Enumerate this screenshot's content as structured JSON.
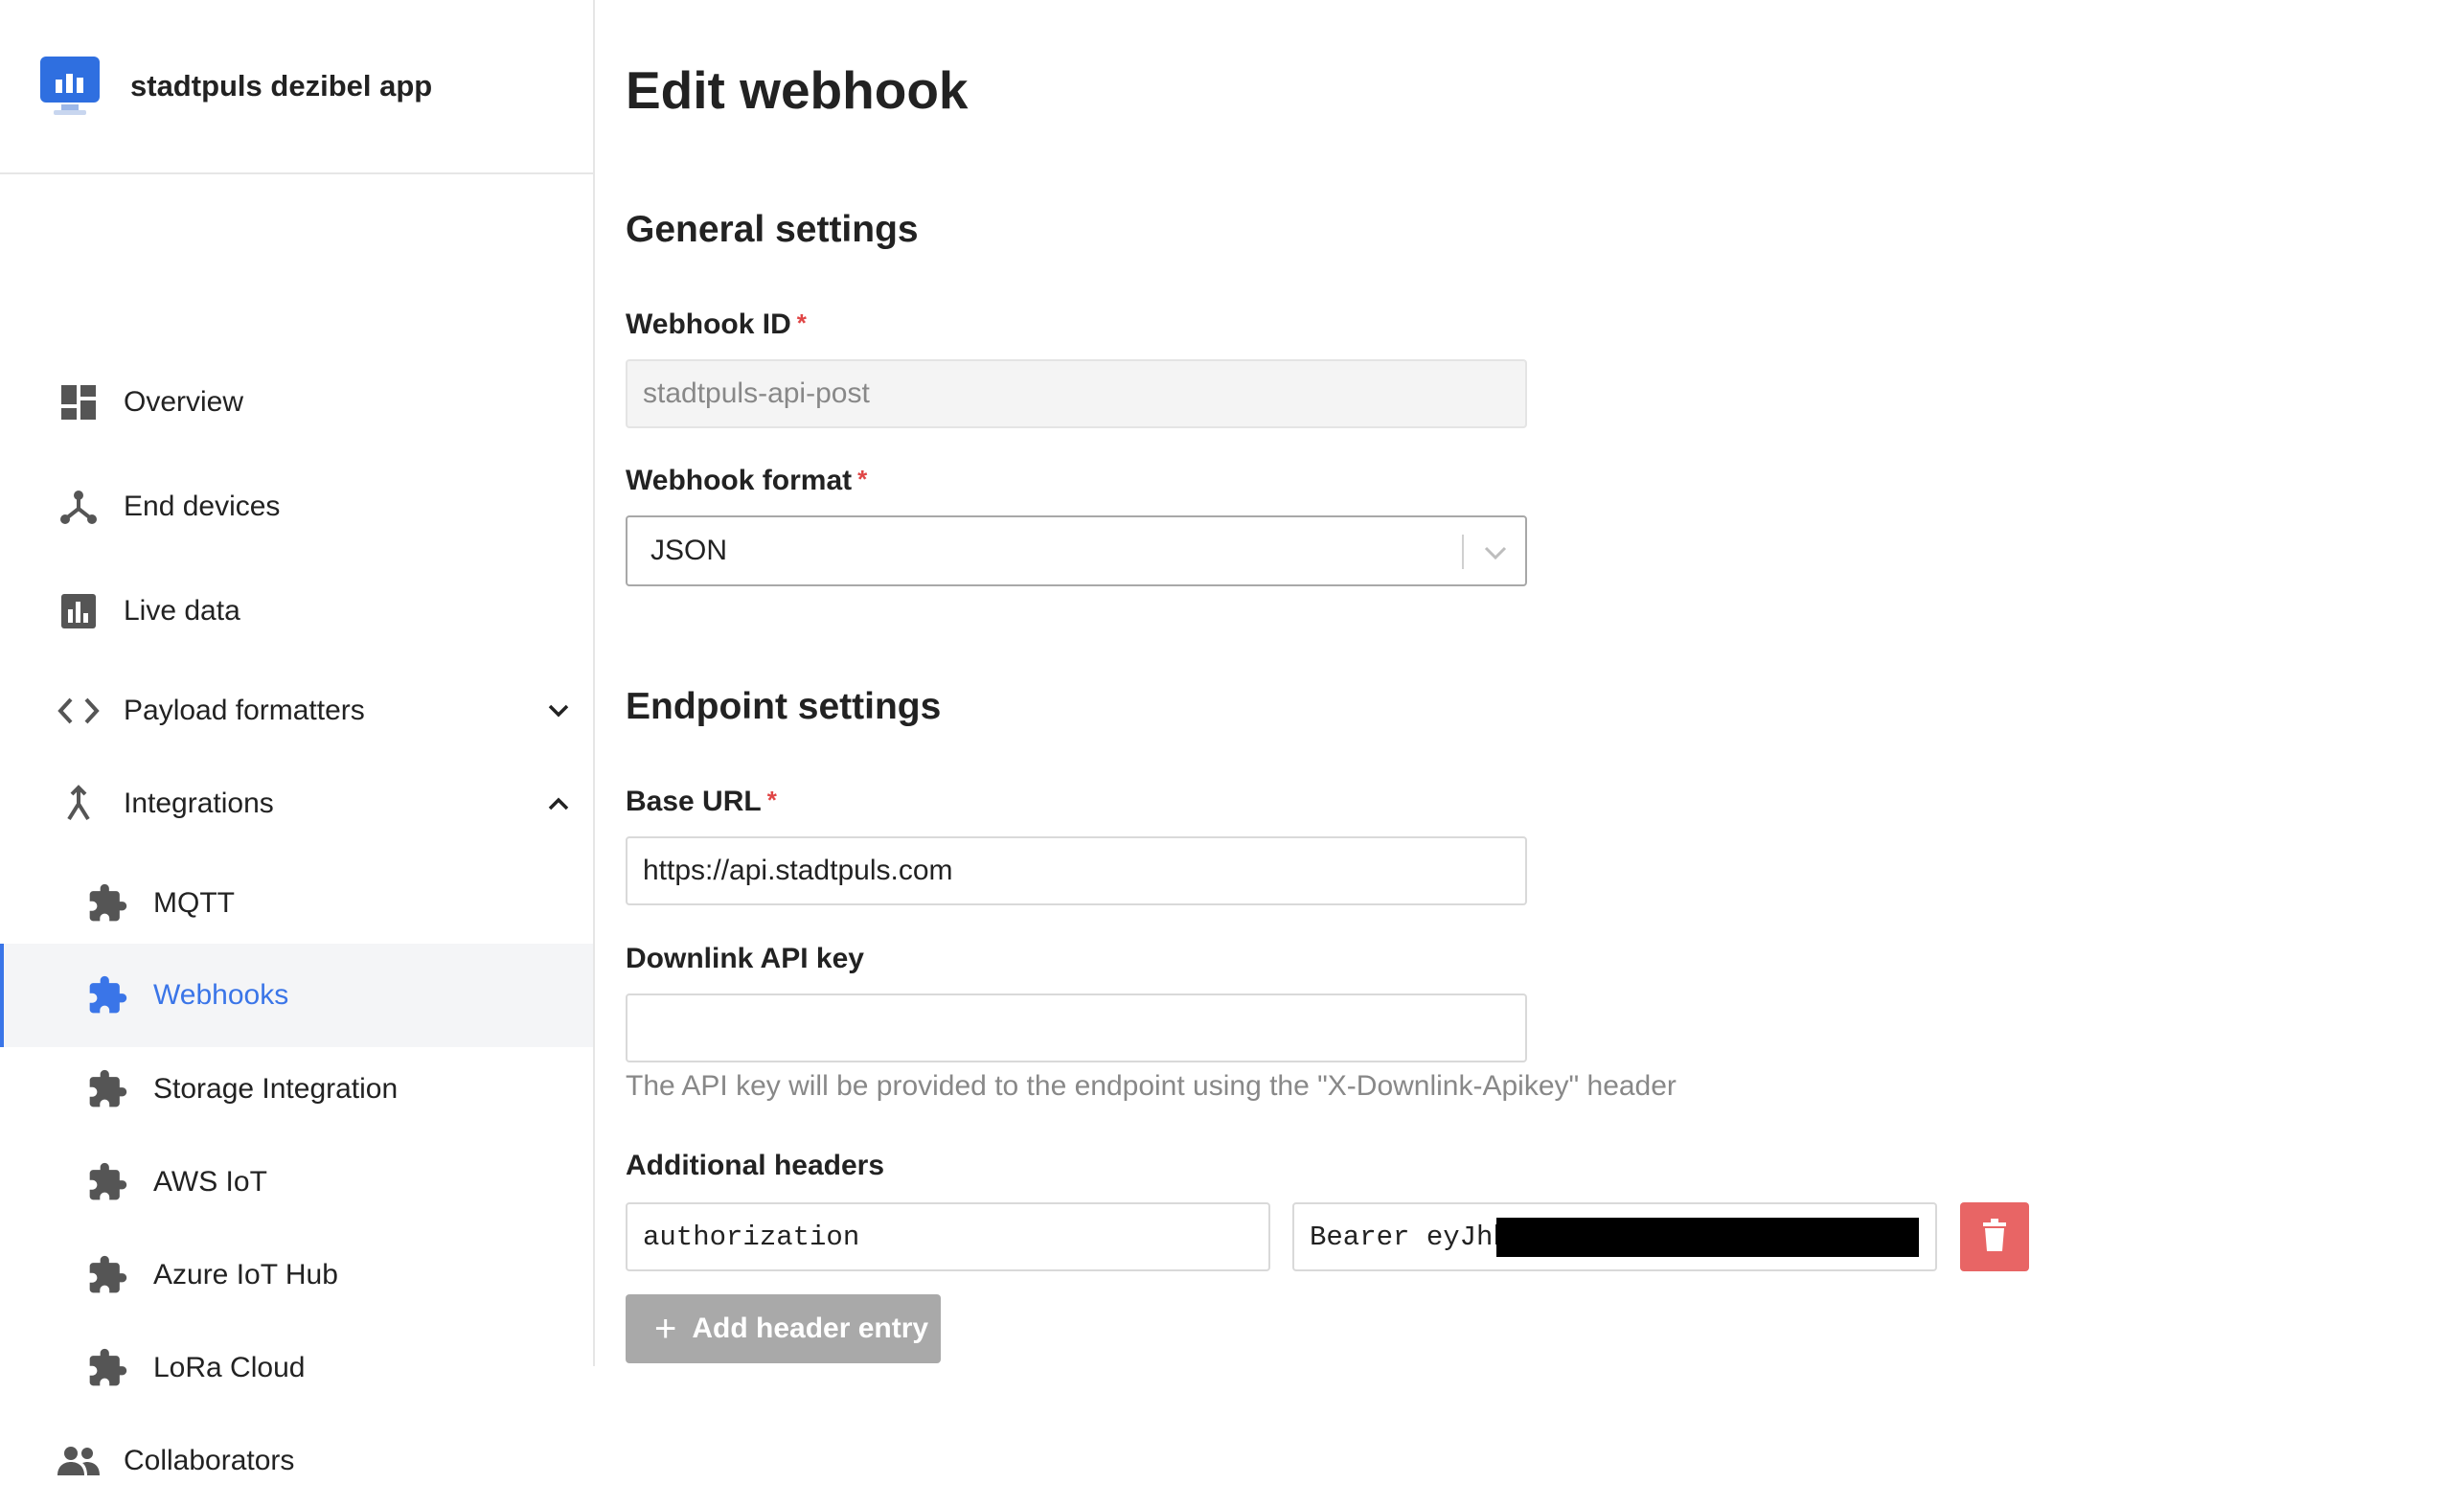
{
  "app": {
    "name": "stadtpuls dezibel app",
    "logo_icon": "monitor-chart-icon"
  },
  "sidebar": {
    "items": [
      {
        "label": "Overview",
        "icon": "dashboard-icon"
      },
      {
        "label": "End devices",
        "icon": "devices-icon"
      },
      {
        "label": "Live data",
        "icon": "bar-chart-icon"
      },
      {
        "label": "Payload formatters",
        "icon": "code-icon",
        "expanded": false
      },
      {
        "label": "Integrations",
        "icon": "merge-icon",
        "expanded": true
      },
      {
        "label": "MQTT",
        "icon": "puzzle-icon"
      },
      {
        "label": "Webhooks",
        "icon": "puzzle-icon",
        "active": true
      },
      {
        "label": "Storage Integration",
        "icon": "puzzle-icon"
      },
      {
        "label": "AWS IoT",
        "icon": "puzzle-icon"
      },
      {
        "label": "Azure IoT Hub",
        "icon": "puzzle-icon"
      },
      {
        "label": "LoRa Cloud",
        "icon": "puzzle-icon"
      },
      {
        "label": "Collaborators",
        "icon": "people-icon"
      }
    ]
  },
  "page": {
    "title": "Edit webhook",
    "general": {
      "title": "General settings",
      "webhook_id_label": "Webhook ID",
      "webhook_id_value": "stadtpuls-api-post",
      "format_label": "Webhook format",
      "format_value": "JSON"
    },
    "endpoint": {
      "title": "Endpoint settings",
      "base_url_label": "Base URL",
      "base_url_value": "https://api.stadtpuls.com",
      "api_key_label": "Downlink API key",
      "api_key_value": "",
      "api_key_description": "The API key will be provided to the endpoint using the \"X-Downlink-Apikey\" header",
      "headers_label": "Additional headers",
      "header_key": "authorization",
      "header_value": "Bearer eyJhb",
      "add_header_label": "Add header entry"
    },
    "required_mark": "*",
    "colors": {
      "accent": "#3a75e8",
      "danger": "#e86565",
      "required": "#e04646",
      "disabled_button": "#a9a9a9"
    }
  }
}
